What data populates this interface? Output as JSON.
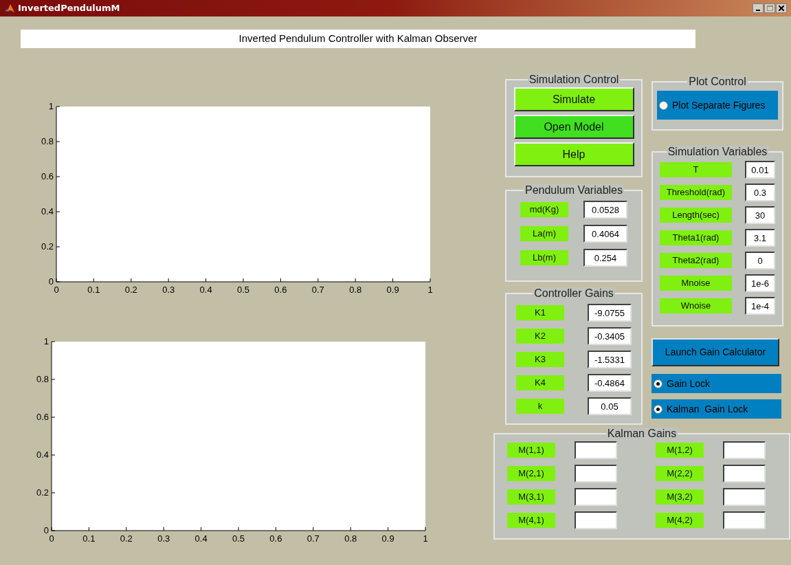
{
  "window": {
    "title": "InvertedPendulumM"
  },
  "header": "Inverted Pendulum Controller with Kalman Observer",
  "plots": [
    {
      "xticks": [
        "0",
        "0.1",
        "0.2",
        "0.3",
        "0.4",
        "0.5",
        "0.6",
        "0.7",
        "0.8",
        "0.9",
        "1"
      ],
      "yticks": [
        "1",
        "0.8",
        "0.6",
        "0.4",
        "0.2",
        "0"
      ]
    },
    {
      "xticks": [
        "0",
        "0.1",
        "0.2",
        "0.3",
        "0.4",
        "0.5",
        "0.6",
        "0.7",
        "0.8",
        "0.9",
        "1"
      ],
      "yticks": [
        "1",
        "0.8",
        "0.6",
        "0.4",
        "0.2",
        "0"
      ]
    }
  ],
  "simulation_control": {
    "title": "Simulation Control",
    "buttons": [
      {
        "label": "Simulate",
        "color": "#80f010"
      },
      {
        "label": "Open Model",
        "color": "#40e020"
      },
      {
        "label": "Help",
        "color": "#80f010"
      }
    ]
  },
  "plot_control": {
    "title": "Plot Control",
    "option": {
      "label": "Plot Separate Figures",
      "checked": false
    }
  },
  "pendulum_variables": {
    "title": "Pendulum Variables",
    "fields": [
      {
        "label": "md(Kg)",
        "value": "0.0528"
      },
      {
        "label": "La(m)",
        "value": "0.4064"
      },
      {
        "label": "Lb(m)",
        "value": "0.254"
      }
    ]
  },
  "simulation_variables": {
    "title": "Simulation Variables",
    "fields": [
      {
        "label": "T",
        "value": "0.01"
      },
      {
        "label": "Threshold(rad)",
        "value": "0.3"
      },
      {
        "label": "Length(sec)",
        "value": "30"
      },
      {
        "label": "Theta1(rad)",
        "value": "3.1"
      },
      {
        "label": "Theta2(rad)",
        "value": "0"
      },
      {
        "label": "Mnoise",
        "value": "1e-6"
      },
      {
        "label": "Wnoise",
        "value": "1e-4"
      }
    ]
  },
  "controller_gains": {
    "title": "Controller Gains",
    "fields": [
      {
        "label": "K1",
        "value": "-9.0755"
      },
      {
        "label": "K2",
        "value": "-0.3405"
      },
      {
        "label": "K3",
        "value": "-1.5331"
      },
      {
        "label": "K4",
        "value": "-0.4864"
      },
      {
        "label": "k",
        "value": "0.05"
      }
    ]
  },
  "launch_button": "Launch Gain Calculator",
  "locks": [
    {
      "label": "Gain Lock",
      "checked": true
    },
    {
      "label": "Kalman  Gain Lock",
      "checked": true
    }
  ],
  "kalman_gains": {
    "title": "Kalman Gains",
    "columns": [
      [
        {
          "label": "M(1,1)"
        },
        {
          "label": "M(2,1)"
        },
        {
          "label": "M(3,1)"
        },
        {
          "label": "M(4,1)"
        }
      ],
      [
        {
          "label": "M(1,2)"
        },
        {
          "label": "M(2,2)"
        },
        {
          "label": "M(3,2)"
        },
        {
          "label": "M(4,2)"
        }
      ]
    ]
  }
}
